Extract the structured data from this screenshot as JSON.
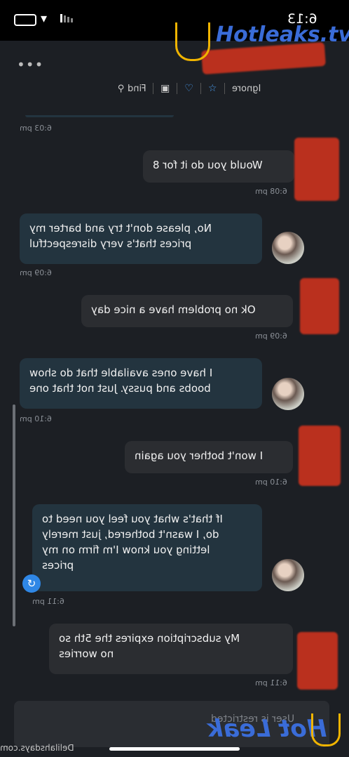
{
  "status": {
    "time": "6:13"
  },
  "toolbar": {
    "ignore": "Ignore",
    "find": "Find"
  },
  "messages": [
    {
      "text": "Would you do it for 8",
      "time": "6:08 pm"
    },
    {
      "text": "No, please don't try and barter my\nprices that's very disrespectful",
      "time": "6:09 pm"
    },
    {
      "text": "Ok no problem have a nice day",
      "time": "6:09 pm"
    },
    {
      "text": "I have ones available that do show\nboobs and pussy. Just not that one",
      "time": "6:10 pm"
    },
    {
      "text": "I won't bother you again",
      "time": "6:10 pm"
    },
    {
      "text": "If that's what you feel you need to\ndo, I wasn't bothered, just merely\nletting you know I'm firm on my\nprices",
      "time": "6:11 pm"
    },
    {
      "text": "My subscription expires the 5th so\nno worries",
      "time": "6:11 pm"
    }
  ],
  "earlier_time": "6:03 pm",
  "input": {
    "placeholder": "User is restricted"
  },
  "watermarks": {
    "top": "Hotleaks.tv",
    "bottom": "Hot Leak",
    "site": "Delilahsdays.com"
  },
  "colors": {
    "background": "#1c1f24",
    "sent_bubble": "#2b2d31",
    "received_bubble": "#23343f",
    "accent": "#4a9df0"
  }
}
